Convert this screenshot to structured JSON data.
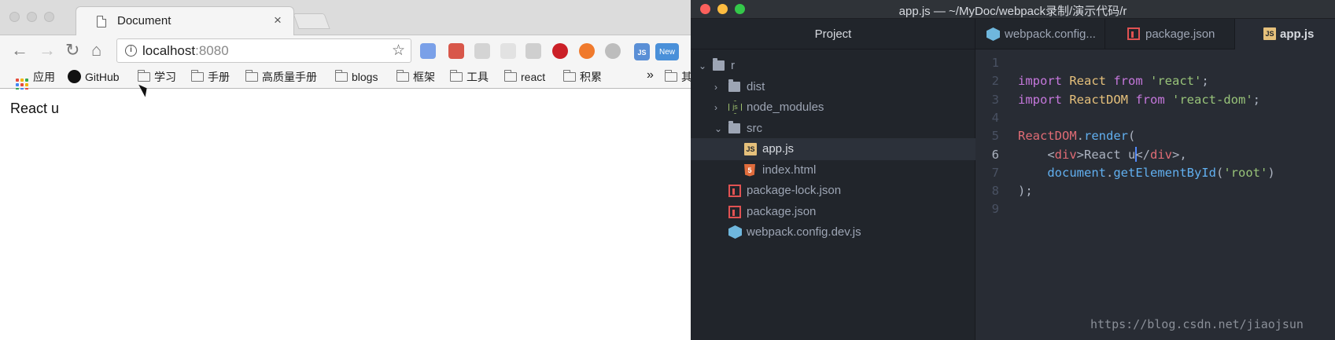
{
  "browser": {
    "tab_title": "Document",
    "tab_close": "×",
    "url_host": "localhost",
    "url_port": ":8080",
    "nav": {
      "back": "←",
      "forward": "→",
      "reload": "↻",
      "home": "⌂",
      "star": "☆",
      "info": "i"
    },
    "bookmarks": [
      {
        "label": "应用",
        "icon": "apps-grid-icon"
      },
      {
        "label": "GitHub",
        "icon": "github-icon"
      },
      {
        "label": "学习",
        "icon": "folder-icon"
      },
      {
        "label": "手册",
        "icon": "folder-icon"
      },
      {
        "label": "高质量手册",
        "icon": "folder-icon"
      },
      {
        "label": "blogs",
        "icon": "folder-icon"
      },
      {
        "label": "框架",
        "icon": "folder-icon"
      },
      {
        "label": "工具",
        "icon": "folder-icon"
      },
      {
        "label": "react",
        "icon": "folder-icon"
      },
      {
        "label": "积累",
        "icon": "folder-icon"
      }
    ],
    "bookmarks_overflow": "»",
    "bookmarks_other": "其",
    "extension_badges": {
      "js": "JS",
      "new": "New"
    },
    "page_text": "React u"
  },
  "atom": {
    "window_title": "app.js — ~/MyDoc/webpack录制/演示代码/r",
    "tree_header": "Project",
    "tree": [
      {
        "label": "r",
        "type": "folder",
        "depth": 0,
        "expanded": true
      },
      {
        "label": "dist",
        "type": "folder",
        "depth": 1,
        "expanded": false
      },
      {
        "label": "node_modules",
        "type": "node",
        "depth": 1,
        "expanded": false
      },
      {
        "label": "src",
        "type": "folder",
        "depth": 1,
        "expanded": true
      },
      {
        "label": "app.js",
        "type": "js",
        "depth": 2,
        "selected": true
      },
      {
        "label": "index.html",
        "type": "html",
        "depth": 2
      },
      {
        "label": "package-lock.json",
        "type": "npm",
        "depth": 1
      },
      {
        "label": "package.json",
        "type": "npm",
        "depth": 1
      },
      {
        "label": "webpack.config.dev.js",
        "type": "webpack",
        "depth": 1
      }
    ],
    "tabs": [
      {
        "label": "webpack.config...",
        "icon": "webpack-icon"
      },
      {
        "label": "package.json",
        "icon": "npm-icon"
      },
      {
        "label": "app.js",
        "icon": "js-icon",
        "active": true
      }
    ],
    "icon_text": {
      "js": "JS",
      "html": "5"
    },
    "code_lines": [
      {
        "n": "1"
      },
      {
        "n": "2",
        "tokens": [
          [
            "kw",
            "import"
          ],
          [
            "",
            ""
          ],
          [
            "cls",
            " React"
          ],
          [
            "kw",
            " from"
          ],
          [
            "str",
            " 'react'"
          ],
          [
            "",
            ";"
          ]
        ]
      },
      {
        "n": "3",
        "tokens": [
          [
            "kw",
            "import"
          ],
          [
            "cls",
            " ReactDOM"
          ],
          [
            "kw",
            " from"
          ],
          [
            "str",
            " 'react-dom'"
          ],
          [
            "",
            ";"
          ]
        ]
      },
      {
        "n": "4"
      },
      {
        "n": "5",
        "tokens": [
          [
            "tag",
            "ReactDOM"
          ],
          [
            "",
            "."
          ],
          [
            "fn",
            "render"
          ],
          [
            "",
            "("
          ]
        ]
      },
      {
        "n": "6",
        "tokens": [
          [
            "",
            "    <"
          ],
          [
            "tag",
            "div"
          ],
          [
            "",
            ">React u"
          ],
          [
            "caret",
            ""
          ],
          [
            "",
            "</"
          ],
          [
            "tag",
            "div"
          ],
          [
            "",
            ">,"
          ]
        ],
        "current": true
      },
      {
        "n": "7",
        "tokens": [
          [
            "fn",
            "    document"
          ],
          [
            "",
            "."
          ],
          [
            "fn",
            "getElementById"
          ],
          [
            "",
            "("
          ],
          [
            "str",
            "'root'"
          ],
          [
            "",
            ")"
          ]
        ]
      },
      {
        "n": "8",
        "tokens": [
          [
            "",
            ");"
          ]
        ]
      },
      {
        "n": "9"
      }
    ]
  },
  "watermark": "https://blog.csdn.net/jiaojsun"
}
